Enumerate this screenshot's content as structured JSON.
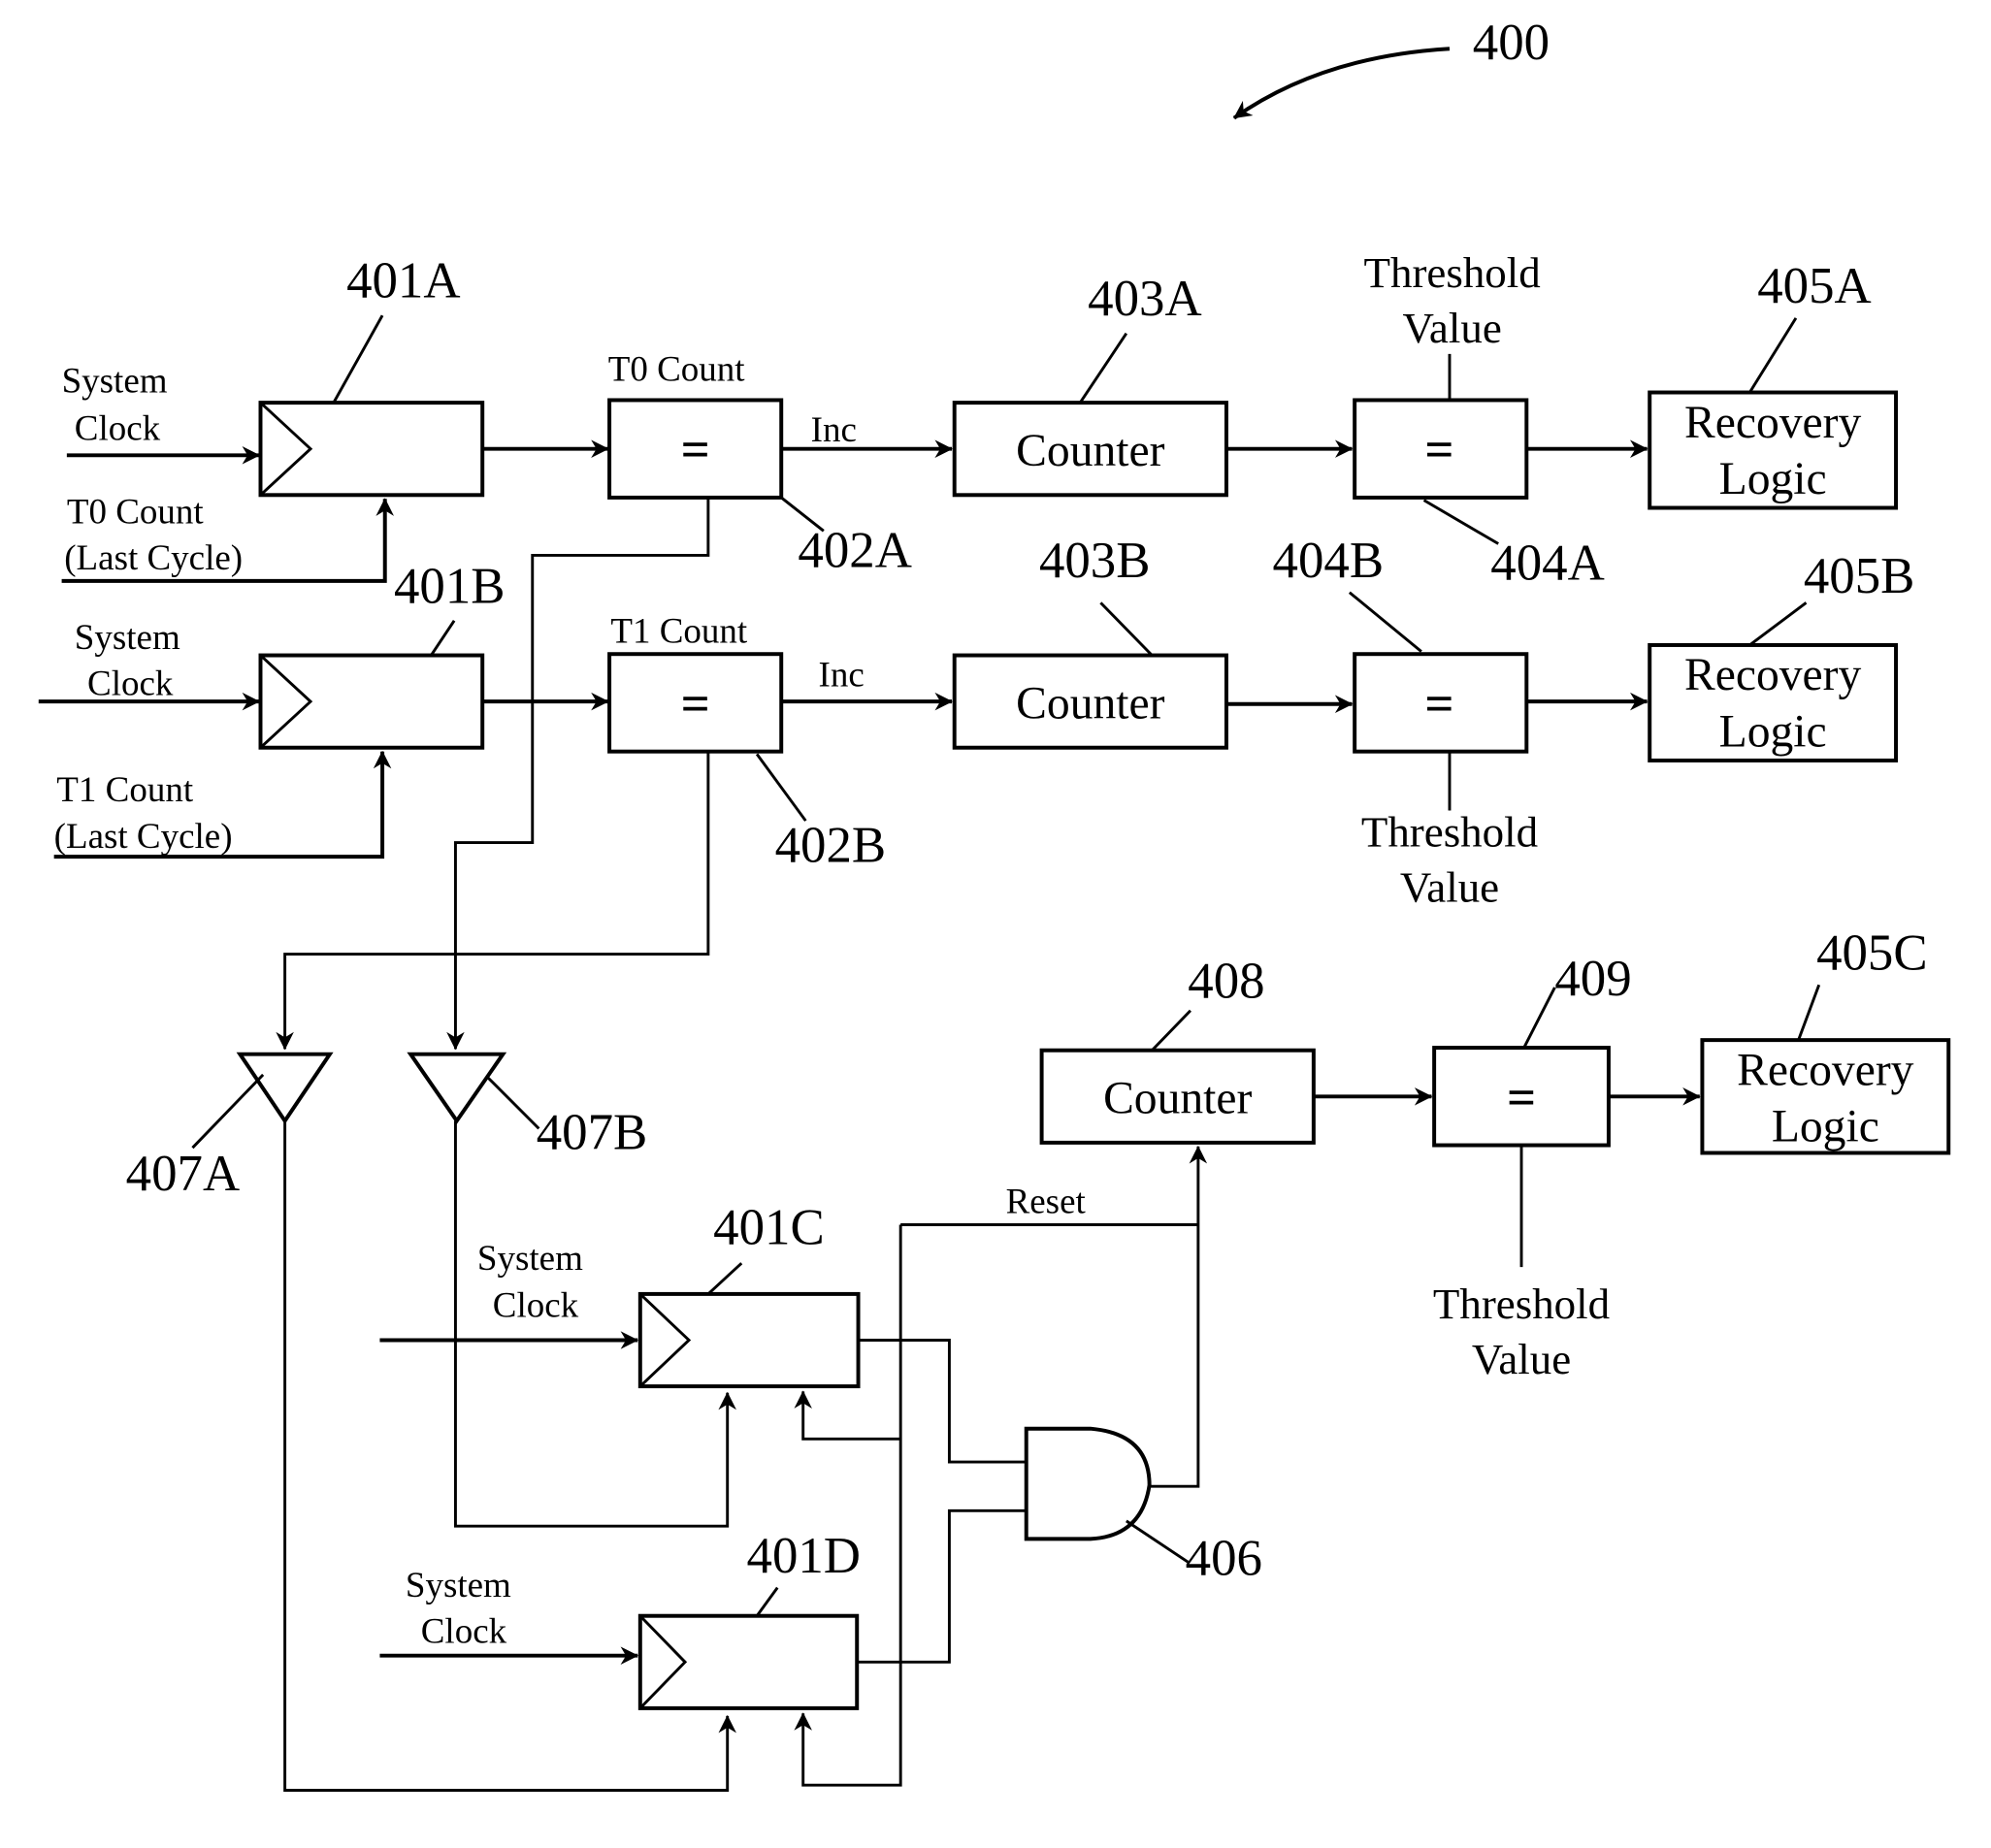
{
  "figure": {
    "ref": "400",
    "colors": {
      "ink": "#000000",
      "paper": "#ffffff"
    }
  },
  "row_a": {
    "flipflop_ref": "401A",
    "clock_label_1": "System",
    "clock_label_2": "Clock",
    "last_label_1": "T0 Count",
    "last_label_2": "(Last Cycle)",
    "comparator_top_label": "T0 Count",
    "comparator_symbol": "=",
    "comparator_ref": "402A",
    "inc_label": "Inc",
    "counter_label": "Counter",
    "counter_ref": "403A",
    "threshold_label_1": "Threshold",
    "threshold_label_2": "Value",
    "threshold_comp_symbol": "=",
    "threshold_comp_ref": "404A",
    "recovery_label_1": "Recovery",
    "recovery_label_2": "Logic",
    "recovery_ref": "405A"
  },
  "row_b": {
    "flipflop_ref": "401B",
    "clock_label_1": "System",
    "clock_label_2": "Clock",
    "last_label_1": "T1 Count",
    "last_label_2": "(Last Cycle)",
    "comparator_top_label": "T1 Count",
    "comparator_symbol": "=",
    "comparator_ref": "402B",
    "inc_label": "Inc",
    "counter_label": "Counter",
    "counter_ref": "403B",
    "threshold_label_1": "Threshold",
    "threshold_label_2": "Value",
    "threshold_comp_symbol": "=",
    "threshold_comp_ref": "404B",
    "recovery_label_1": "Recovery",
    "recovery_label_2": "Logic",
    "recovery_ref": "405B"
  },
  "bottom": {
    "buffer_a_ref": "407A",
    "buffer_b_ref": "407B",
    "flipflop_c_ref": "401C",
    "flipflop_d_ref": "401D",
    "clock_c_label_1": "System",
    "clock_c_label_2": "Clock",
    "clock_d_label_1": "System",
    "clock_d_label_2": "Clock",
    "and_gate_ref": "406",
    "reset_label": "Reset",
    "counter_label": "Counter",
    "counter_ref": "408",
    "comparator_symbol": "=",
    "comparator_ref": "409",
    "threshold_label_1": "Threshold",
    "threshold_label_2": "Value",
    "recovery_label_1": "Recovery",
    "recovery_label_2": "Logic",
    "recovery_ref": "405C"
  }
}
